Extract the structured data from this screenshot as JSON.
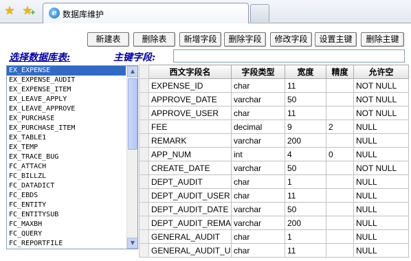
{
  "browser": {
    "tab_title": "数据库维护"
  },
  "toolbar": {
    "buttons": [
      "新建表",
      "删除表",
      "新增字段",
      "删除字段",
      "修改字段",
      "设置主键",
      "删除主键"
    ]
  },
  "labels": {
    "select_db_table": "选择数据库表:",
    "primary_key": "主键字段:"
  },
  "primary_key_field": {
    "value": ""
  },
  "table_list": {
    "selected": "EX_EXPENSE",
    "items": [
      "EX_EXPENSE",
      "EX_EXPENSE_AUDIT",
      "EX_EXPENSE_ITEM",
      "EX_LEAVE_APPLY",
      "EX_LEAVE_APPROVE",
      "EX_PURCHASE",
      "EX_PURCHASE_ITEM",
      "EX_TABLE1",
      "EX_TEMP",
      "EX_TRACE_BUG",
      "FC_ATTACH",
      "FC_BILLZL",
      "FC_DATADICT",
      "FC_EBDS",
      "FC_ENTITY",
      "FC_ENTITYSUB",
      "FC_MAXBH",
      "FC_QUERY",
      "FC_REPORTFILE"
    ]
  },
  "field_grid": {
    "columns": [
      "西文字段名",
      "字段类型",
      "宽度",
      "精度",
      "允许空"
    ],
    "rows": [
      [
        "EXPENSE_ID",
        "char",
        "11",
        "",
        "NOT NULL"
      ],
      [
        "APPROVE_DATE",
        "varchar",
        "50",
        "",
        "NOT NULL"
      ],
      [
        "APPROVE_USER",
        "char",
        "11",
        "",
        "NOT NULL"
      ],
      [
        "FEE",
        "decimal",
        "9",
        "2",
        "NULL"
      ],
      [
        "REMARK",
        "varchar",
        "200",
        "",
        "NULL"
      ],
      [
        "APP_NUM",
        "int",
        "4",
        "0",
        "NULL"
      ],
      [
        "CREATE_DATE",
        "varchar",
        "50",
        "",
        "NOT NULL"
      ],
      [
        "DEPT_AUDIT",
        "char",
        "1",
        "",
        "NULL"
      ],
      [
        "DEPT_AUDIT_USER",
        "char",
        "11",
        "",
        "NULL"
      ],
      [
        "DEPT_AUDIT_DATE",
        "varchar",
        "50",
        "",
        "NULL"
      ],
      [
        "DEPT_AUDIT_REMARK",
        "varchar",
        "200",
        "",
        "NULL"
      ],
      [
        "GENERAL_AUDIT",
        "char",
        "1",
        "",
        "NULL"
      ],
      [
        "GENERAL_AUDIT_USER",
        "char",
        "11",
        "",
        "NULL"
      ]
    ]
  },
  "colors": {
    "selection": "#316ac5",
    "label_blue": "#0000aa"
  }
}
